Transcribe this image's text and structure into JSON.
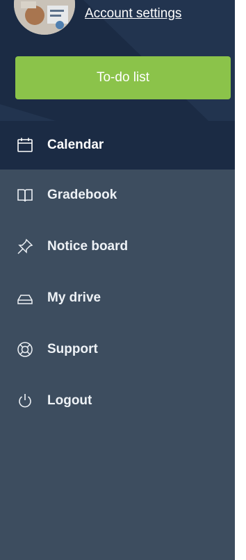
{
  "header": {
    "account_settings_label": "Account settings",
    "todo_label": "To-do list",
    "todo_color": "#8bc34a"
  },
  "nav": {
    "items": [
      {
        "label": "Calendar",
        "icon": "calendar-icon",
        "active": true
      },
      {
        "label": "Gradebook",
        "icon": "book-icon",
        "active": false
      },
      {
        "label": "Notice board",
        "icon": "pin-icon",
        "active": false
      },
      {
        "label": "My drive",
        "icon": "drive-icon",
        "active": false
      },
      {
        "label": "Support",
        "icon": "lifebuoy-icon",
        "active": false
      },
      {
        "label": "Logout",
        "icon": "power-icon",
        "active": false
      }
    ]
  },
  "colors": {
    "sidebar_bg": "#3d4d5f",
    "header_bg": "#1b2b44",
    "active_bg": "#1b2b44",
    "text": "#ffffff"
  }
}
